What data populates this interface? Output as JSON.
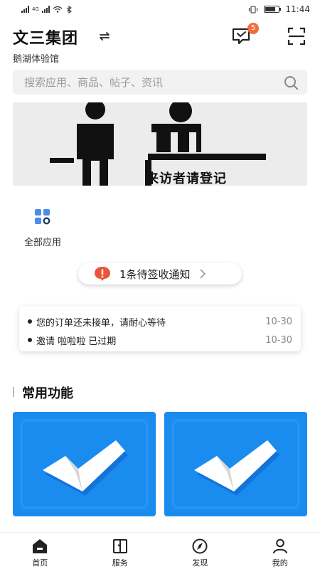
{
  "status_bar": {
    "network": "4G",
    "time": "11:44"
  },
  "header": {
    "org_name": "文三集团",
    "venue": "鹅湖体验馆",
    "message_badge": "5"
  },
  "search": {
    "placeholder": "搜索应用、商品、帖子、资讯"
  },
  "banner": {
    "text": "来访者请登记"
  },
  "apps": {
    "all_apps_label": "全部应用"
  },
  "pending": {
    "text": "1条待签收通知"
  },
  "notices": [
    {
      "text": "您的订单还未接单，请耐心等待",
      "date": "10-30"
    },
    {
      "text": "邀请 啦啦啦 已过期",
      "date": "10-30"
    }
  ],
  "common_functions": {
    "title": "常用功能"
  },
  "nav": {
    "items": [
      {
        "label": "首页",
        "icon": "home-icon"
      },
      {
        "label": "服务",
        "icon": "book-icon"
      },
      {
        "label": "发现",
        "icon": "compass-icon"
      },
      {
        "label": "我的",
        "icon": "user-icon"
      }
    ]
  },
  "colors": {
    "accent_blue": "#1a8cf0",
    "badge_orange": "#f26b3a",
    "alert_red": "#e8553a"
  }
}
